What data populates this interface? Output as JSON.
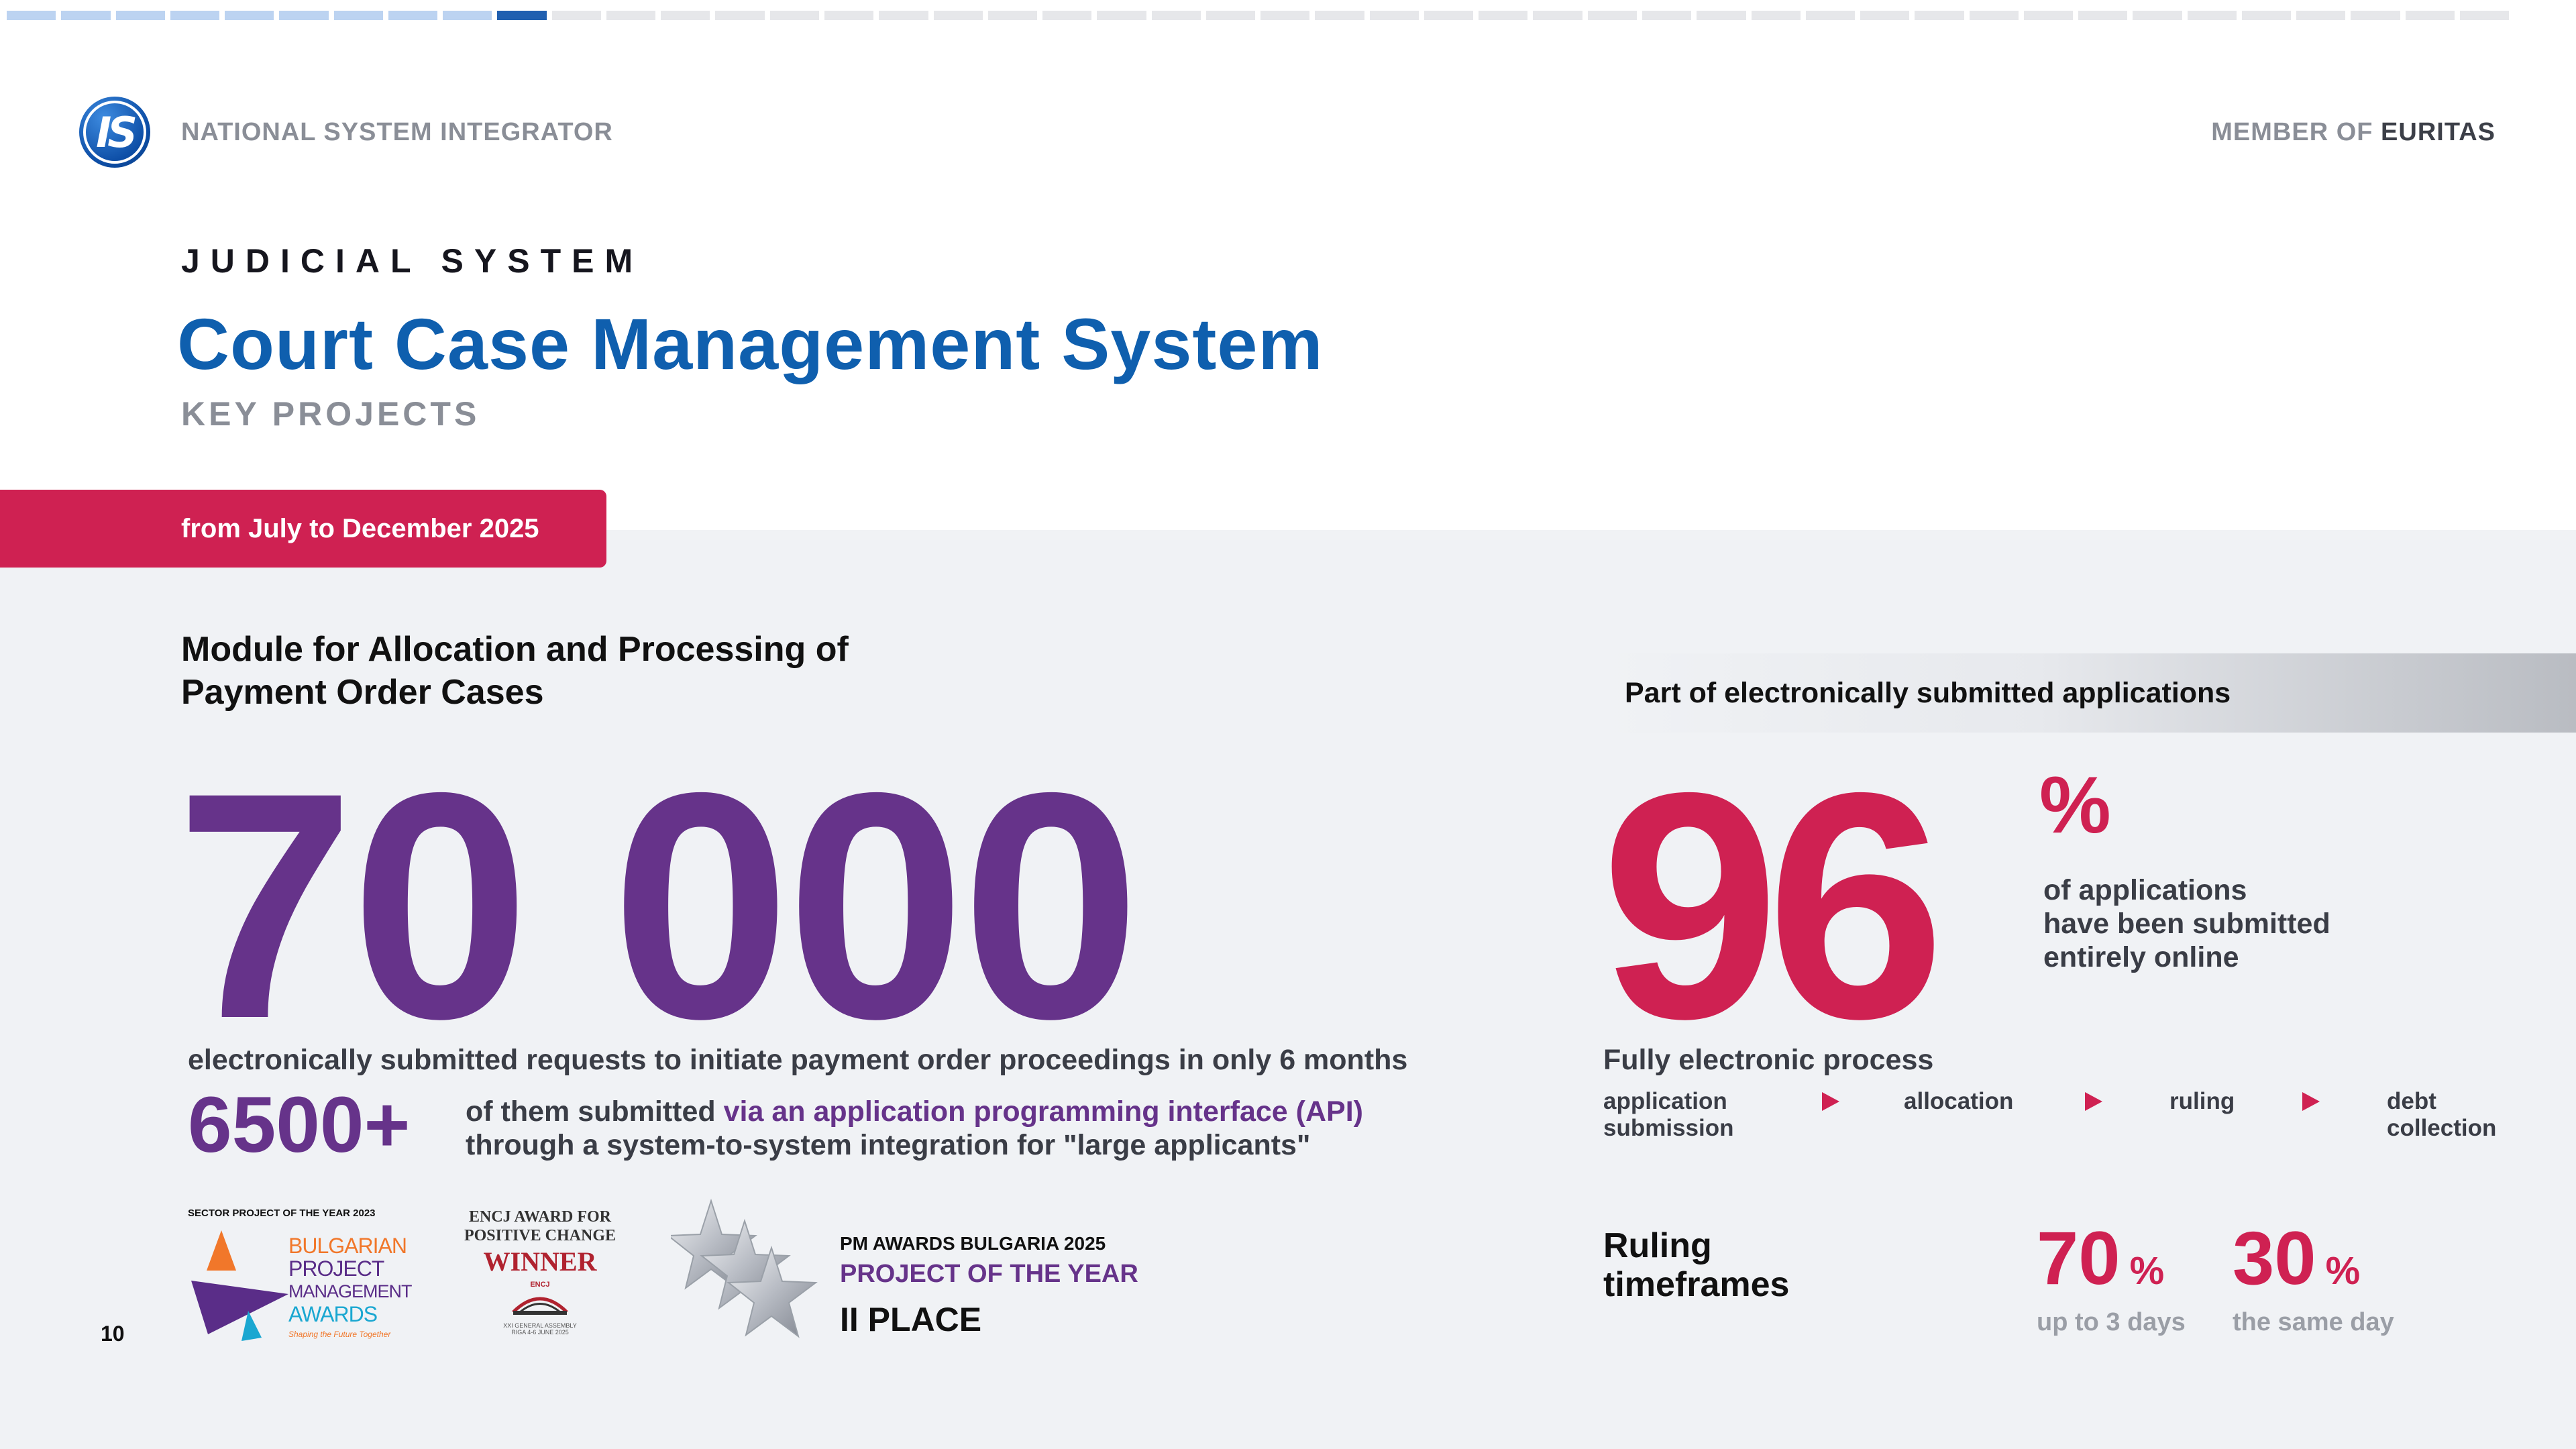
{
  "progress": {
    "total_segments": 46,
    "completed_segments": 9,
    "current_segment": 10
  },
  "header": {
    "logo_text": "IS",
    "organization": "NATIONAL SYSTEM INTEGRATOR",
    "member_prefix": "MEMBER OF",
    "member_name": "EURITAS"
  },
  "title_block": {
    "section": "JUDICIAL SYSTEM",
    "title": "Court Case Management System",
    "subtitle": "KEY PROJECTS"
  },
  "period": "from July to December 2025",
  "left": {
    "module_title_line1": "Module for Allocation and Processing of",
    "module_title_line2": "Payment Order Cases",
    "big_number": "70 000",
    "big_desc": "electronically submitted requests to initiate payment order proceedings in only 6 months",
    "api_number": "6500+",
    "api_text_prefix": "of them submitted ",
    "api_text_highlight": "via an application programming interface (API)",
    "api_text_line2": "through a system-to-system integration for \"large applicants\""
  },
  "awards": {
    "bpma_caption": "SECTOR PROJECT OF THE YEAR 2023",
    "bpma_line1": "BULGARIAN",
    "bpma_line2": "PROJECT",
    "bpma_line3": "MANAGEMENT",
    "bpma_line4": "AWARDS",
    "bpma_tagline": "Shaping the Future Together",
    "encj_line1": "ENCJ AWARD FOR",
    "encj_line2": "POSITIVE CHANGE",
    "encj_winner": "WINNER",
    "encj_logo": "ENCJ",
    "encj_sub1": "XXI GENERAL ASSEMBLY",
    "encj_sub2": "RIGA 4-6 JUNE 2025",
    "pm_label": "PM AWARDS BULGARIA 2025",
    "pm_title": "PROJECT OF THE YEAR",
    "pm_place": "II PLACE"
  },
  "page_number": "10",
  "right": {
    "bar_title": "Part of electronically submitted applications",
    "percent_value": "96",
    "percent_sign": "%",
    "percent_desc_1": "of applications",
    "percent_desc_2": "have been submitted",
    "percent_desc_3": "entirely online",
    "process_title": "Fully electronic process",
    "process_steps": [
      {
        "line1": "application",
        "line2": "submission"
      },
      {
        "line1": "allocation",
        "line2": ""
      },
      {
        "line1": "ruling",
        "line2": ""
      },
      {
        "line1": "debt",
        "line2": "collection"
      }
    ],
    "ruling_title_1": "Ruling",
    "ruling_title_2": "timeframes",
    "ruling_items": [
      {
        "value": "70",
        "unit": "%",
        "caption": "up to 3 days"
      },
      {
        "value": "30",
        "unit": "%",
        "caption": "the same day"
      }
    ]
  },
  "colors": {
    "brand_blue": "#0f5fae",
    "purple": "#66338a",
    "crimson": "#cf2152",
    "grey_text": "#8a8e97",
    "panel_bg": "#f0f2f5"
  }
}
